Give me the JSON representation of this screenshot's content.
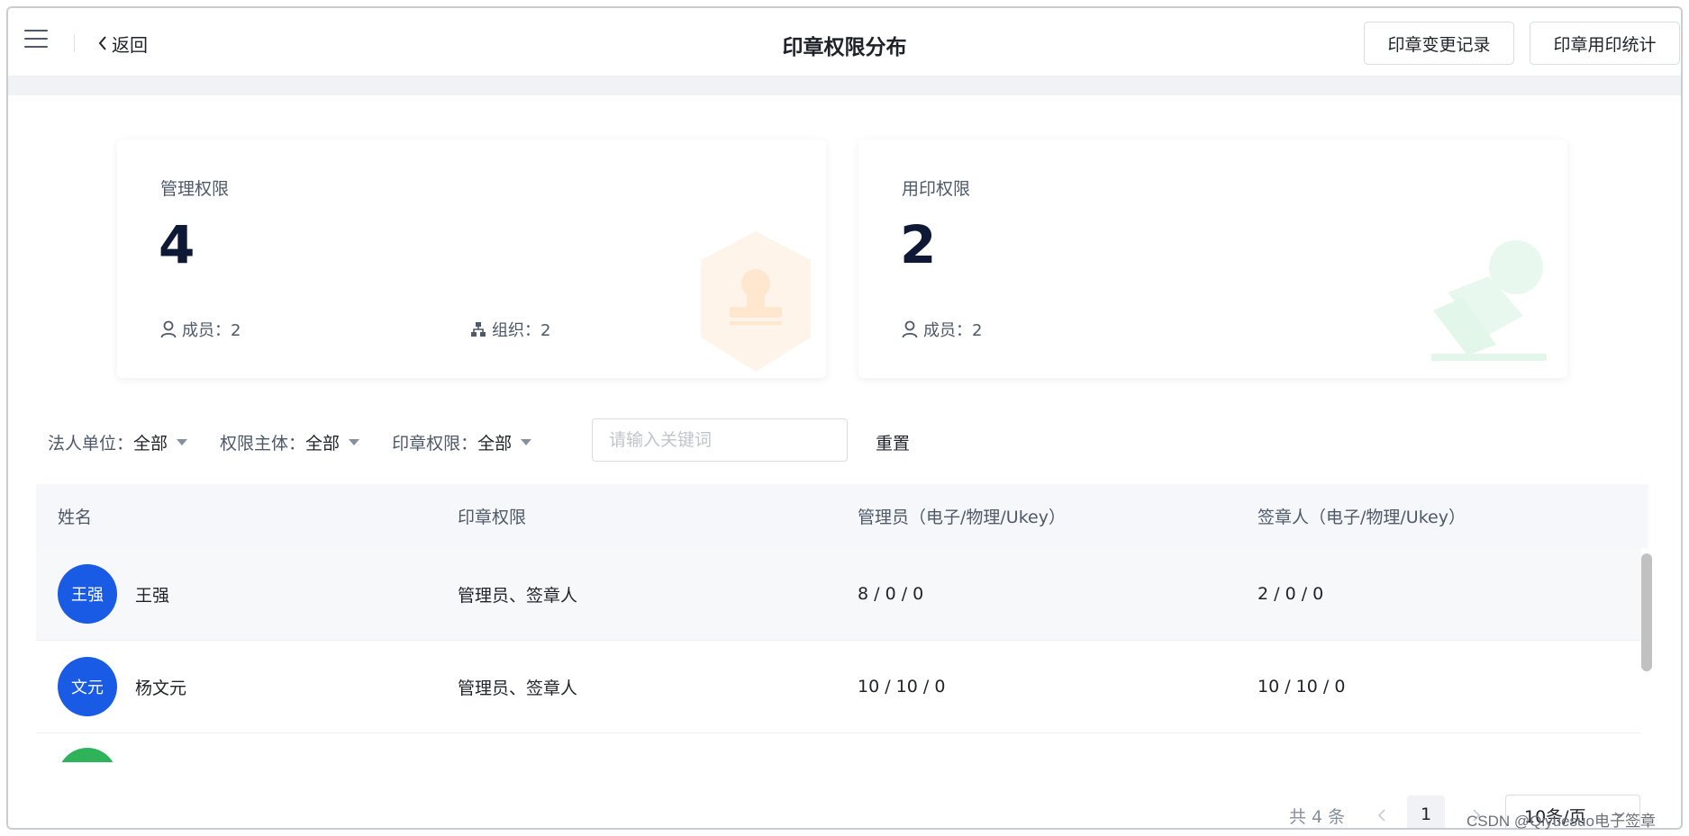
{
  "header": {
    "back_label": "返回",
    "title": "印章权限分布",
    "change_log_label": "印章变更记录",
    "usage_stats_label": "印章用印统计"
  },
  "cards": {
    "manage": {
      "label": "管理权限",
      "count": "4",
      "members": "成员：2",
      "orgs": "组织：2",
      "accent": "#ff9a3c"
    },
    "use": {
      "label": "用印权限",
      "count": "2",
      "members": "成员：2",
      "accent": "#2fbf71"
    }
  },
  "filters": [
    {
      "label": "法人单位：",
      "value": "全部"
    },
    {
      "label": "权限主体：",
      "value": "全部"
    },
    {
      "label": "印章权限：",
      "value": "全部"
    }
  ],
  "search": {
    "placeholder": "请输入关键词",
    "value": ""
  },
  "reset_label": "重置",
  "table": {
    "columns": [
      "姓名",
      "印章权限",
      "管理员（电子/物理/Ukey）",
      "签章人（电子/物理/Ukey）"
    ],
    "rows": [
      {
        "avatar_text": "王强",
        "avatar_color": "#1a5be6",
        "name": "王强",
        "permission": "管理员、签章人",
        "admin": "8 / 0 / 0",
        "signer": "2 / 0 / 0"
      },
      {
        "avatar_text": "文元",
        "avatar_color": "#1a5be6",
        "name": "杨文元",
        "permission": "管理员、签章人",
        "admin": "10 / 10 / 0",
        "signer": "10 / 10 / 0"
      },
      {
        "avatar_text": "",
        "avatar_color": "#2fb35a",
        "name": "",
        "permission": "",
        "admin": "",
        "signer": ""
      }
    ]
  },
  "pagination": {
    "total": "共 4 条",
    "current_page": "1",
    "page_size": "10条/页"
  },
  "watermark": "CSDN @Qiyuesuo电子签章"
}
